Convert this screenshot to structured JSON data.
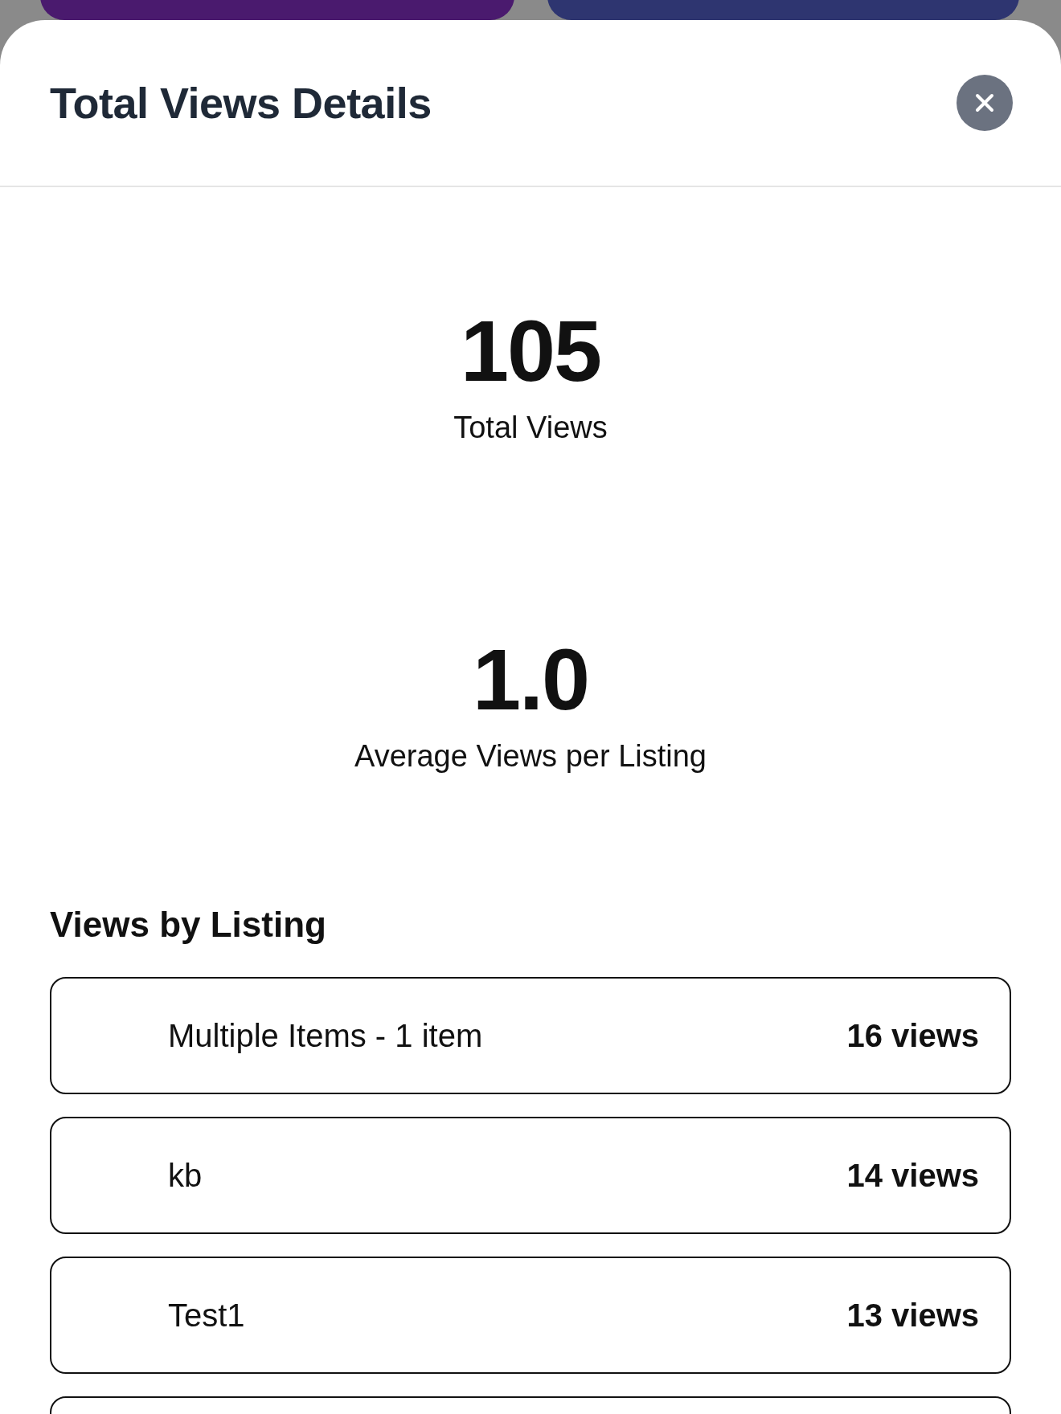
{
  "sheet": {
    "title": "Total Views Details"
  },
  "stats": [
    {
      "value": "105",
      "label": "Total Views"
    },
    {
      "value": "1.0",
      "label": "Average Views per Listing"
    }
  ],
  "section_title": "Views by Listing",
  "listings": [
    {
      "name": "Multiple Items - 1 item",
      "views": "16 views"
    },
    {
      "name": "kb",
      "views": "14 views"
    },
    {
      "name": "Test1",
      "views": "13 views"
    }
  ]
}
